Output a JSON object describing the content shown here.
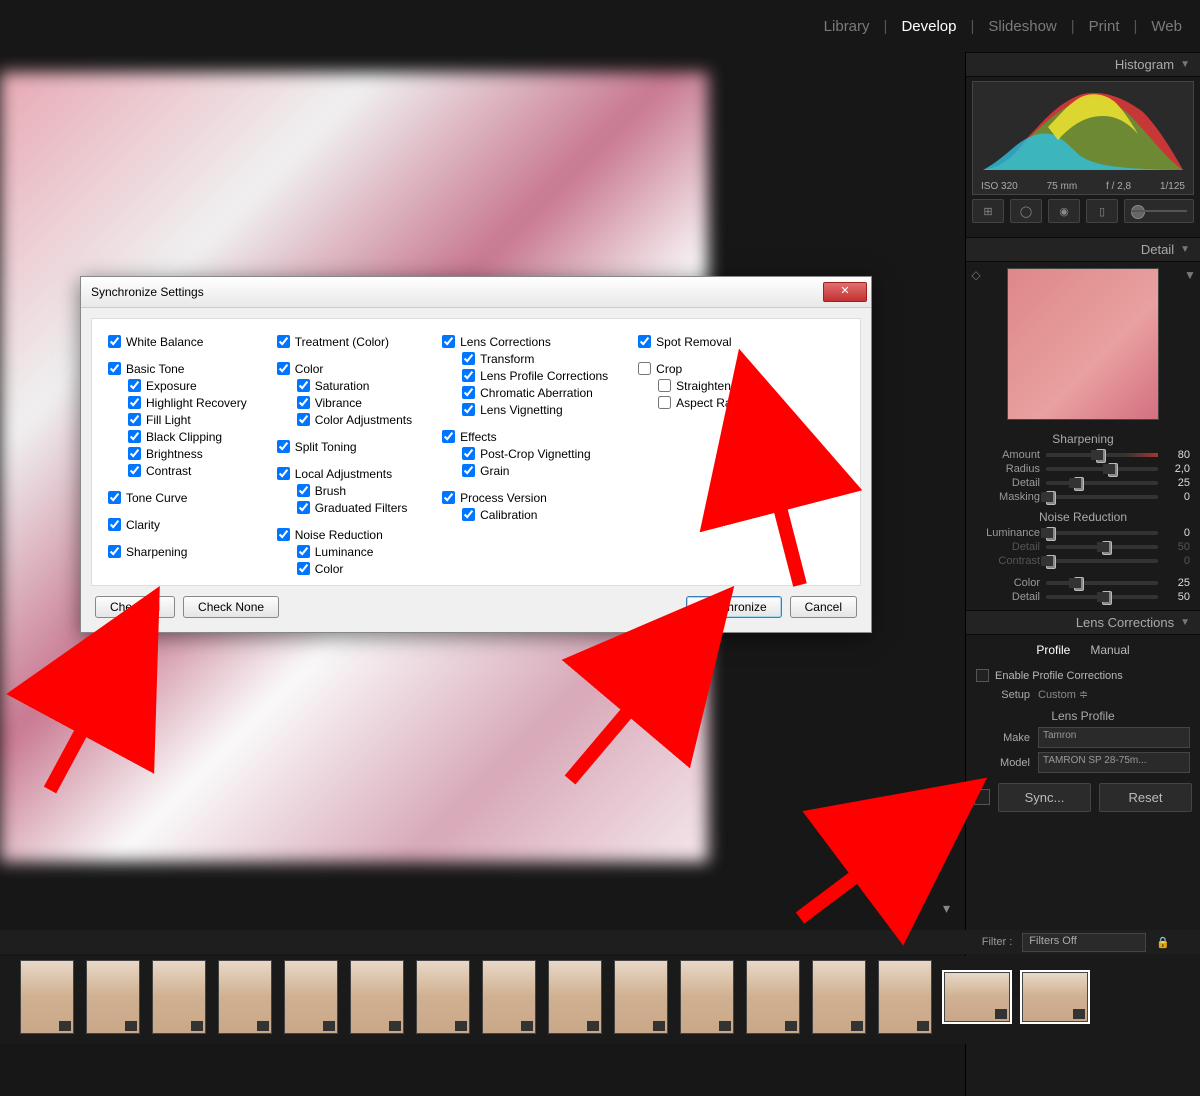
{
  "nav": {
    "library": "Library",
    "develop": "Develop",
    "slideshow": "Slideshow",
    "print": "Print",
    "web": "Web"
  },
  "panels": {
    "histogram": "Histogram",
    "detail": "Detail",
    "lens": "Lens Corrections"
  },
  "meta": {
    "iso": "ISO 320",
    "fl": "75 mm",
    "ap": "f / 2,8",
    "sh": "1/125"
  },
  "sharpen": {
    "title": "Sharpening",
    "rows": [
      {
        "label": "Amount",
        "val": "80",
        "pos": 45
      },
      {
        "label": "Radius",
        "val": "2,0",
        "pos": 55
      },
      {
        "label": "Detail",
        "val": "25",
        "pos": 25
      },
      {
        "label": "Masking",
        "val": "0",
        "pos": 0
      }
    ]
  },
  "nr": {
    "title": "Noise Reduction",
    "rows": [
      {
        "label": "Luminance",
        "val": "0",
        "pos": 0
      },
      {
        "label": "Detail",
        "val": "50",
        "pos": 50,
        "dim": true
      },
      {
        "label": "Contrast",
        "val": "0",
        "pos": 0,
        "dim": true
      },
      {
        "label": "Color",
        "val": "25",
        "pos": 25,
        "gap": true
      },
      {
        "label": "Detail",
        "val": "50",
        "pos": 50
      }
    ]
  },
  "lens": {
    "tabs": {
      "profile": "Profile",
      "manual": "Manual"
    },
    "enable": "Enable Profile Corrections",
    "setup_label": "Setup",
    "setup_value": "Custom  ≑",
    "profile_title": "Lens Profile",
    "make_label": "Make",
    "make_value": "Tamron",
    "model_label": "Model",
    "model_value": "TAMRON SP 28-75m..."
  },
  "buttons": {
    "sync": "Sync...",
    "reset": "Reset"
  },
  "filter": {
    "label": "Filter :",
    "value": "Filters Off"
  },
  "dialog": {
    "title": "Synchronize Settings",
    "col1": [
      {
        "t": "White Balance",
        "c": true
      },
      {
        "gap": true
      },
      {
        "t": "Basic Tone",
        "c": true
      },
      {
        "t": "Exposure",
        "c": true,
        "s": true
      },
      {
        "t": "Highlight Recovery",
        "c": true,
        "s": true
      },
      {
        "t": "Fill Light",
        "c": true,
        "s": true
      },
      {
        "t": "Black Clipping",
        "c": true,
        "s": true
      },
      {
        "t": "Brightness",
        "c": true,
        "s": true
      },
      {
        "t": "Contrast",
        "c": true,
        "s": true
      },
      {
        "gap": true
      },
      {
        "t": "Tone Curve",
        "c": true
      },
      {
        "gap": true
      },
      {
        "t": "Clarity",
        "c": true
      },
      {
        "gap": true
      },
      {
        "t": "Sharpening",
        "c": true
      }
    ],
    "col2": [
      {
        "t": "Treatment (Color)",
        "c": true
      },
      {
        "gap": true
      },
      {
        "t": "Color",
        "c": true
      },
      {
        "t": "Saturation",
        "c": true,
        "s": true
      },
      {
        "t": "Vibrance",
        "c": true,
        "s": true
      },
      {
        "t": "Color Adjustments",
        "c": true,
        "s": true
      },
      {
        "gap": true
      },
      {
        "t": "Split Toning",
        "c": true
      },
      {
        "gap": true
      },
      {
        "t": "Local Adjustments",
        "c": true
      },
      {
        "t": "Brush",
        "c": true,
        "s": true
      },
      {
        "t": "Graduated Filters",
        "c": true,
        "s": true
      },
      {
        "gap": true
      },
      {
        "t": "Noise Reduction",
        "c": true
      },
      {
        "t": "Luminance",
        "c": true,
        "s": true
      },
      {
        "t": "Color",
        "c": true,
        "s": true
      }
    ],
    "col3": [
      {
        "t": "Lens Corrections",
        "c": true
      },
      {
        "t": "Transform",
        "c": true,
        "s": true
      },
      {
        "t": "Lens Profile Corrections",
        "c": true,
        "s": true
      },
      {
        "t": "Chromatic Aberration",
        "c": true,
        "s": true
      },
      {
        "t": "Lens Vignetting",
        "c": true,
        "s": true
      },
      {
        "gap": true
      },
      {
        "t": "Effects",
        "c": true
      },
      {
        "t": "Post-Crop Vignetting",
        "c": true,
        "s": true
      },
      {
        "t": "Grain",
        "c": true,
        "s": true
      },
      {
        "gap": true
      },
      {
        "t": "Process Version",
        "c": true
      },
      {
        "t": "Calibration",
        "c": true,
        "s": true
      }
    ],
    "col4": [
      {
        "t": "Spot Removal",
        "c": true
      },
      {
        "gap": true
      },
      {
        "t": "Crop",
        "c": false
      },
      {
        "t": "Straighten Angle",
        "c": false,
        "s": true
      },
      {
        "t": "Aspect Ratio",
        "c": false,
        "s": true
      }
    ],
    "check_all": "Check All",
    "check_none": "Check None",
    "synchronize": "Synchronize",
    "cancel": "Cancel"
  }
}
